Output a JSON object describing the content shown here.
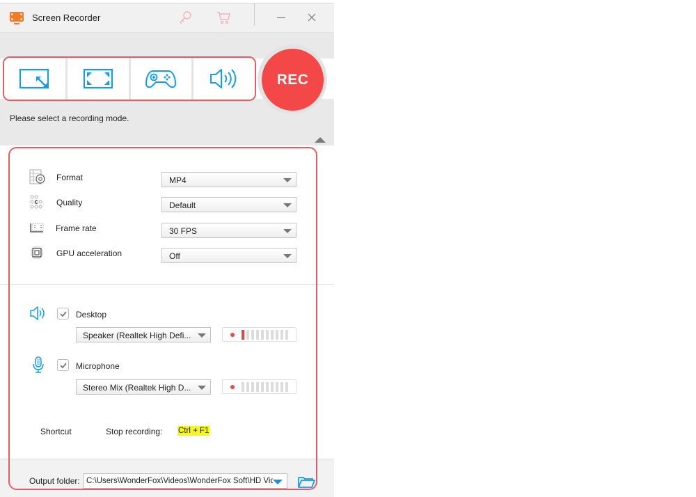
{
  "window": {
    "title": "Screen Recorder",
    "icons": [
      "app-logo-icon",
      "key-icon",
      "cart-icon",
      "minimize-icon",
      "close-icon"
    ]
  },
  "modes": {
    "buttons": [
      {
        "name": "custom-region",
        "icon": "resize-region-icon"
      },
      {
        "name": "fullscreen",
        "icon": "fullscreen-icon"
      },
      {
        "name": "game",
        "icon": "gamepad-icon"
      },
      {
        "name": "audio-only",
        "icon": "speaker-icon"
      }
    ],
    "rec_label": "REC",
    "hint": "Please select a recording mode."
  },
  "settings": {
    "format": {
      "label": "Format",
      "value": "MP4",
      "icon": "format-gear-icon"
    },
    "quality": {
      "label": "Quality",
      "value": "Default",
      "icon": "quality-dots-icon"
    },
    "frame_rate": {
      "label": "Frame rate",
      "value": "30 FPS",
      "icon": "frame-rate-icon"
    },
    "gpu": {
      "label": "GPU acceleration",
      "value": "Off",
      "icon": "chip-icon"
    }
  },
  "audio": {
    "desktop": {
      "label": "Desktop",
      "checked": true,
      "device": "Speaker (Realtek High Defi...",
      "level_segments_total": 10,
      "level_segments_active": 1
    },
    "microphone": {
      "label": "Microphone",
      "checked": true,
      "device": "Stereo Mix (Realtek High D...",
      "level_segments_total": 10,
      "level_segments_active": 0
    }
  },
  "shortcut": {
    "label": "Shortcut",
    "stop_label": "Stop recording:",
    "stop_key": "Ctrl + F1"
  },
  "output": {
    "label": "Output folder:",
    "path": "C:\\Users\\WonderFox\\Videos\\WonderFox Soft\\HD Video Converter Factory Pro"
  },
  "colors": {
    "accent_blue": "#1a8ed8",
    "rec_red": "#f44747",
    "highlight_frame": "#e06060",
    "hotkey_highlight": "#f6f622",
    "app_orange": "#f07b2a"
  }
}
